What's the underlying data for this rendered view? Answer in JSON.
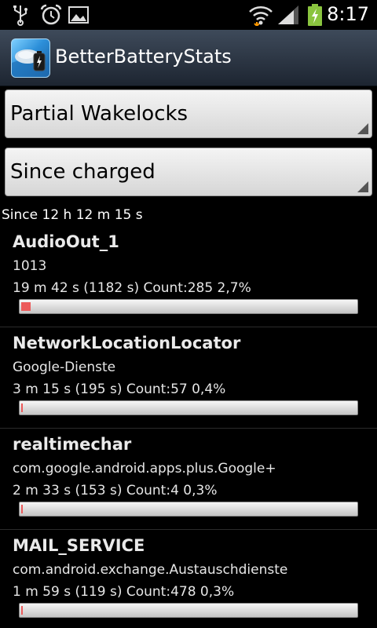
{
  "status_bar": {
    "time": "8:17",
    "icons": [
      "usb-icon",
      "alarm-clock-icon",
      "picture-icon",
      "wifi-icon",
      "signal-icon",
      "battery-charging-icon"
    ]
  },
  "action_bar": {
    "title": "BetterBatteryStats"
  },
  "stat_type_spinner": {
    "selected": "Partial Wakelocks"
  },
  "since_spinner": {
    "selected": "Since charged"
  },
  "since_label": "Since 12 h 12 m 15 s",
  "wakelocks": [
    {
      "name": "AudioOut_1",
      "sub": "1013",
      "stats": "19 m 42 s  (1182 s) Count:285 2,7%",
      "percent": 2.7
    },
    {
      "name": "NetworkLocationLocator",
      "sub": "Google-Dienste",
      "stats": "3 m 15 s  (195 s) Count:57 0,4%",
      "percent": 0.4
    },
    {
      "name": "realtimechar",
      "sub": "com.google.android.apps.plus.Google+",
      "stats": "2 m 33 s  (153 s) Count:4 0,3%",
      "percent": 0.3
    },
    {
      "name": "MAIL_SERVICE",
      "sub": "com.android.exchange.Austauschdienste",
      "stats": "1 m 59 s  (119 s) Count:478 0,3%",
      "percent": 0.3
    }
  ],
  "colors": {
    "bar_fill": "#ec5a5a",
    "action_bar": "#2d3848",
    "battery_green": "#8ac43f"
  }
}
